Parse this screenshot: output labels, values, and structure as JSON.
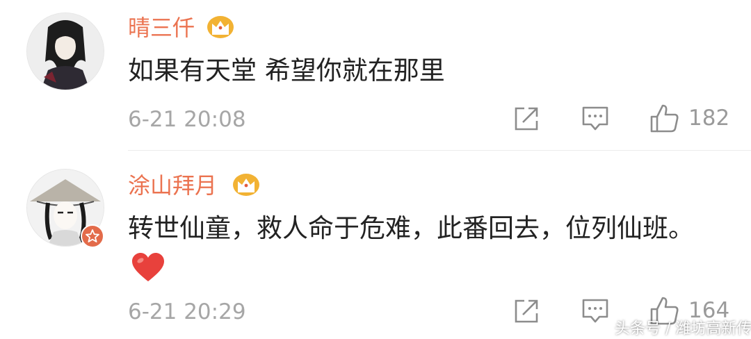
{
  "comments": [
    {
      "username": "晴三仟",
      "text": "如果有天堂 希望你就在那里",
      "time": "6-21 20:08",
      "likes": "182"
    },
    {
      "username": "涂山拜月",
      "text": "转世仙童，救人命于危难，此番回去，位列仙班。",
      "emoji": "heart-emoji",
      "time": "6-21 20:29",
      "likes": "164"
    }
  ],
  "watermark": "头条号 / 潍坊高新传媒",
  "colors": {
    "username": "#eb7350",
    "text": "#222222",
    "meta": "#a6a6a6",
    "crown": "#f2b233",
    "heart": "#e8413c",
    "vip_badge": "#e36b4a"
  },
  "icons": [
    "crown-vip-icon",
    "share-icon",
    "reply-icon",
    "like-icon",
    "vip-star-badge-icon"
  ]
}
